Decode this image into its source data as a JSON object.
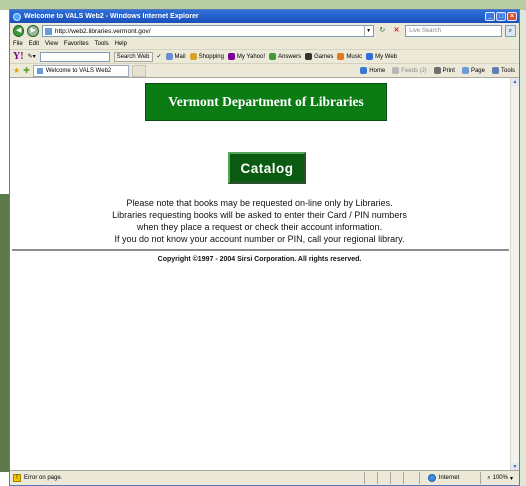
{
  "window": {
    "title": "Welcome to VALS Web2 - Windows Internet Explorer",
    "minimize": "_",
    "maximize": "□",
    "close": "×"
  },
  "address": {
    "url": "http://web2.libraries.vermont.gov/",
    "search_placeholder": "Live Search"
  },
  "menu": [
    "File",
    "Edit",
    "View",
    "Favorites",
    "Tools",
    "Help"
  ],
  "yahoo_toolbar": {
    "logo": "Y!",
    "search_button": "Search Web",
    "items": [
      {
        "label": "Mail",
        "icon": "mail-icon",
        "color": "#6a8fd0"
      },
      {
        "label": "Shopping",
        "icon": "shopping-icon",
        "color": "#d9a22b"
      },
      {
        "label": "My Yahoo!",
        "icon": "my-yahoo-icon",
        "color": "#7b0099"
      },
      {
        "label": "Answers",
        "icon": "answers-icon",
        "color": "#3c9c3c"
      },
      {
        "label": "Games",
        "icon": "games-icon",
        "color": "#333333"
      },
      {
        "label": "Music",
        "icon": "music-icon",
        "color": "#e07a1f"
      },
      {
        "label": "My Web",
        "icon": "my-web-icon",
        "color": "#2f6fd8"
      }
    ]
  },
  "tabs": [
    {
      "label": "Welcome to VALS Web2"
    }
  ],
  "command_bar": [
    {
      "label": "Home",
      "icon": "home-icon",
      "color": "#3a78d0"
    },
    {
      "label": "Feeds (J)",
      "icon": "feeds-icon",
      "color": "#b8b8b8"
    },
    {
      "label": "Print",
      "icon": "print-icon",
      "color": "#707070"
    },
    {
      "label": "Page",
      "icon": "page-icon",
      "color": "#6a9ad8"
    },
    {
      "label": "Tools",
      "icon": "tools-icon",
      "color": "#5d7fb5"
    }
  ],
  "page": {
    "header": "Vermont Department of Libraries",
    "catalog_button": "Catalog",
    "notice_lines": [
      "Please note that books may be requested on-line only by Libraries.",
      "Libraries requesting books will be asked to enter their Card / PIN numbers",
      "when they place a request or check their account information.",
      "If you do not know your account number or PIN, call your regional library."
    ],
    "copyright": "Copyright ©1997 - 2004 Sirsi Corporation. All rights reserved."
  },
  "status": {
    "text": "Error on page.",
    "zone": "Internet",
    "zoom": "100%"
  },
  "colors": {
    "banner_green": "#0b7b13",
    "button_green": "#0a5a12",
    "titlebar_blue": "#1a4fb8"
  }
}
